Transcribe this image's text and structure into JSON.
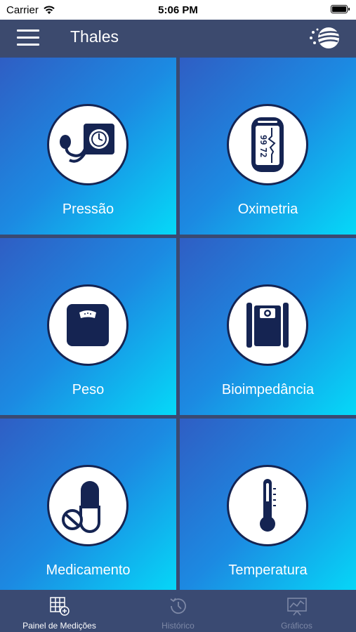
{
  "status_bar": {
    "carrier": "Carrier",
    "time": "5:06 PM"
  },
  "navbar": {
    "title": "Thales",
    "menu_icon": "hamburger-icon",
    "logo": "thales-logo"
  },
  "tiles": [
    {
      "label": "Pressão",
      "icon": "blood-pressure-icon"
    },
    {
      "label": "Oximetria",
      "icon": "oximeter-icon",
      "display_top": "99",
      "display_bottom": "72"
    },
    {
      "label": "Peso",
      "icon": "scale-icon"
    },
    {
      "label": "Bioimpedância",
      "icon": "bioimpedance-icon"
    },
    {
      "label": "Medicamento",
      "icon": "medication-icon"
    },
    {
      "label": "Temperatura",
      "icon": "thermometer-icon"
    }
  ],
  "tab_bar": {
    "items": [
      {
        "label": "Painel de Medições",
        "icon": "dashboard-icon",
        "active": true
      },
      {
        "label": "Histórico",
        "icon": "history-icon",
        "active": false
      },
      {
        "label": "Gráficos",
        "icon": "charts-icon",
        "active": false
      }
    ]
  },
  "colors": {
    "navbar": "#3c4a6e",
    "tile_start": "#2f5ec4",
    "tile_end": "#05d9f8",
    "icon_navy": "#152452",
    "tab_inactive": "#7d88a6"
  }
}
